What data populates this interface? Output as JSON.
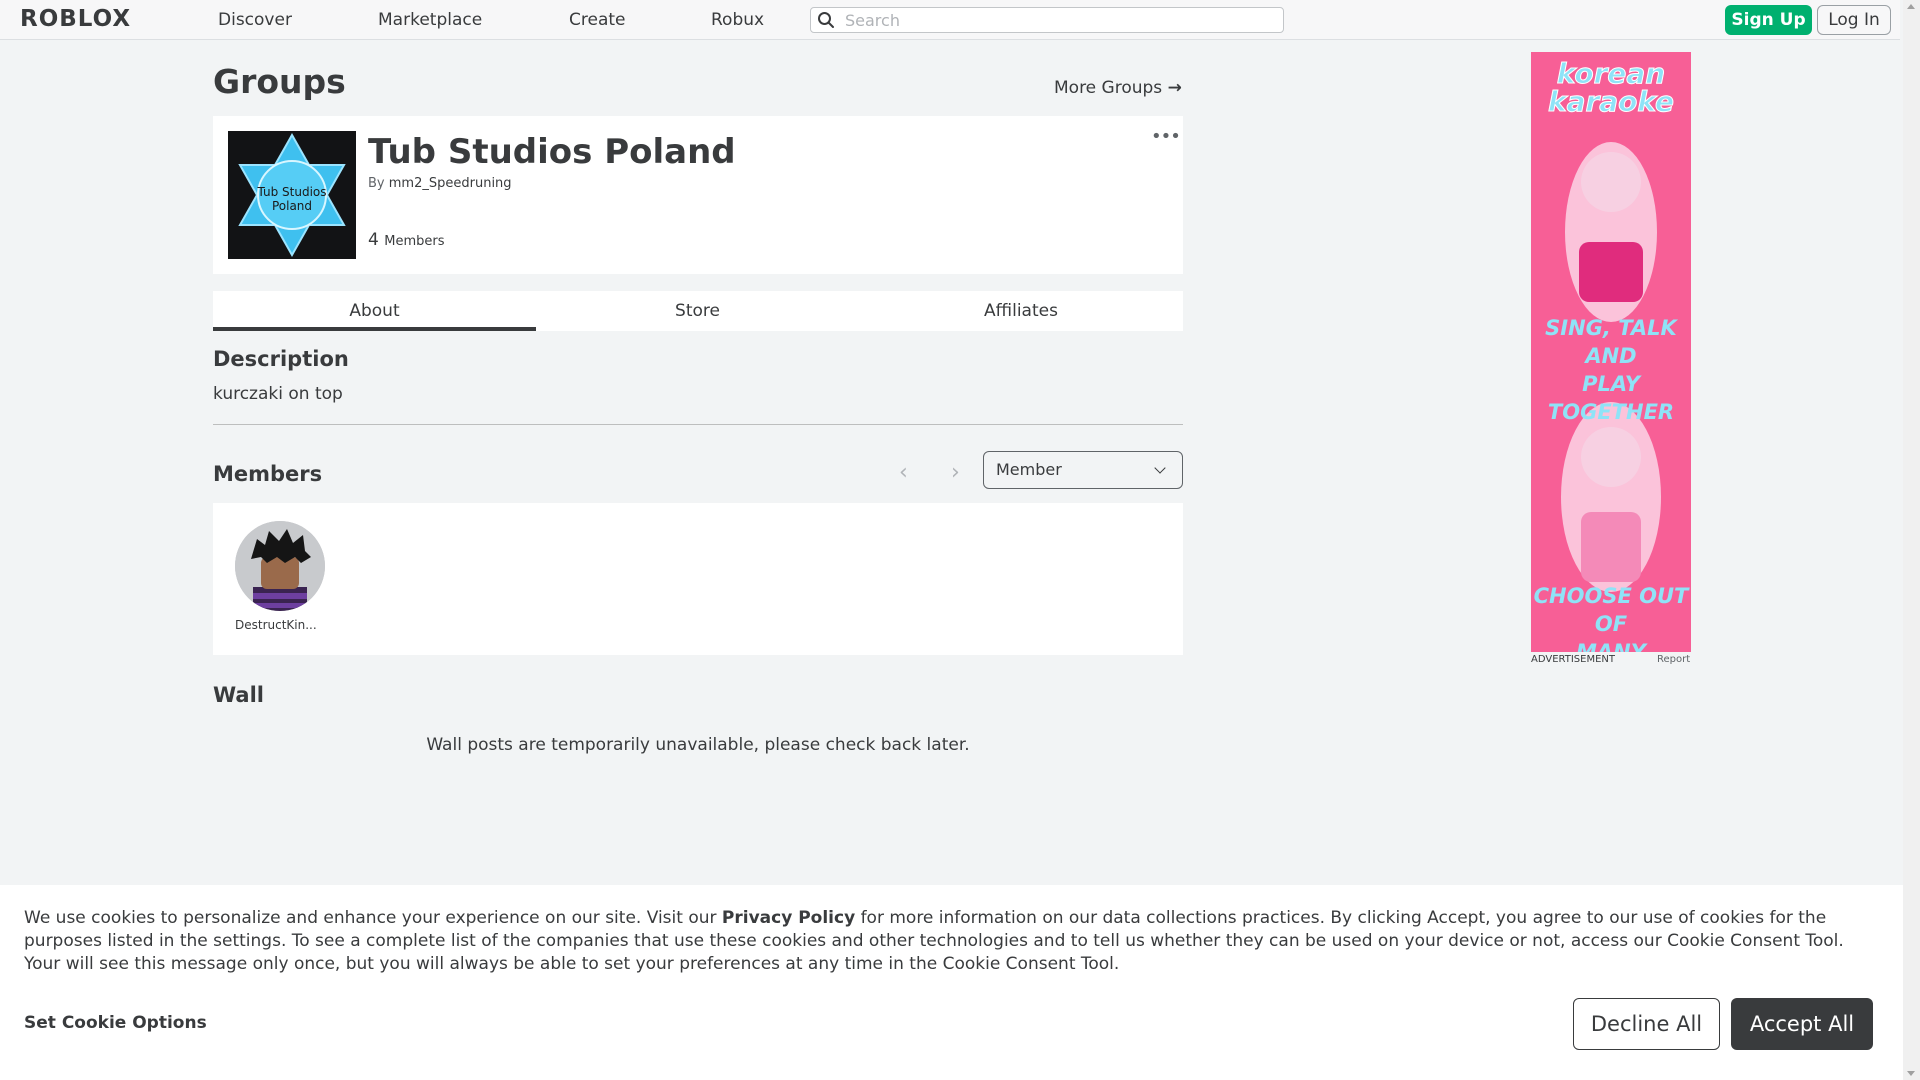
{
  "header": {
    "logo": "ROBLOX",
    "nav": [
      {
        "label": "Discover"
      },
      {
        "label": "Marketplace"
      },
      {
        "label": "Create"
      },
      {
        "label": "Robux"
      }
    ],
    "search_placeholder": "Search",
    "signup_label": "Sign Up",
    "login_label": "Log In",
    "icons": {
      "search": "magnifier-icon"
    }
  },
  "page": {
    "title": "Groups",
    "more_groups": "More Groups",
    "more_groups_arrow": "→"
  },
  "group": {
    "name": "Tub Studios Poland",
    "emblem_text_line1": "Tub Studios",
    "emblem_text_line2": "Poland",
    "by_label": "By",
    "owner": "mm2_Speedruning",
    "member_count": "4",
    "members_label": "Members",
    "more_icon": "ellipsis-icon"
  },
  "tabs": [
    {
      "label": "About",
      "active": true
    },
    {
      "label": "Store",
      "active": false
    },
    {
      "label": "Affiliates",
      "active": false
    }
  ],
  "about": {
    "description_title": "Description",
    "description_text": "kurczaki on top",
    "members_title": "Members",
    "pager_prev": "‹",
    "pager_next": "›",
    "role_filter_value": "Member",
    "members": [
      {
        "name": "DestructKin..."
      }
    ],
    "wall_title": "Wall",
    "wall_message": "Wall posts are temporarily unavailable, please check back later."
  },
  "ad": {
    "headline_1": "korean",
    "headline_2": "karaoke",
    "middle_1": "SING, TALK AND",
    "middle_2": "PLAY TOGETHER",
    "footer_1": "CHOOSE OUT OF",
    "footer_2": "MANY SONGS!",
    "label": "ADVERTISEMENT",
    "report": "Report"
  },
  "cookie_banner": {
    "text_before_link": "We use cookies to personalize and enhance your experience on our site. Visit our ",
    "link_text": "Privacy Policy",
    "text_after_link": " for more information on our data collections practices. By clicking Accept, you agree to our use of cookies for the purposes listed in the settings. To see a complete list of the companies that use these cookies and other technologies and to tell us whether they can be used on your device or not, access our Cookie Consent Tool. Your will see this message only once, but you will always be able to set your preferences at any time in the Cookie Consent Tool.",
    "set_options": "Set Cookie Options",
    "decline": "Decline All",
    "accept": "Accept All"
  },
  "colors": {
    "signup_green": "#00b06f",
    "dark_button": "#393b3d",
    "page_bg": "#f2f4f5",
    "emblem_blue": "#3fc0ef"
  }
}
